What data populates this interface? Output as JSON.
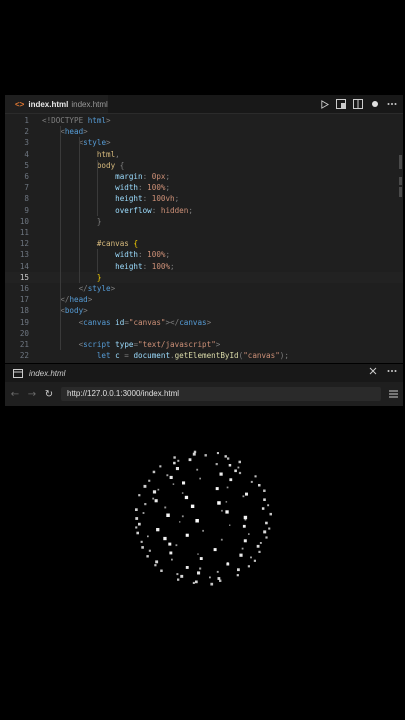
{
  "editor_tab": {
    "icon": "<>",
    "filename": "index.html",
    "path": "index.html"
  },
  "editor_toolbar": [
    "run-icon",
    "split-preview-icon",
    "split-editor-icon",
    "dirty-dot-icon",
    "more-icon"
  ],
  "code_lines": [
    {
      "num": "1",
      "parts": [
        [
          "cmt",
          "<!DOCTYPE "
        ],
        [
          "tag",
          "html"
        ],
        [
          "cmt",
          ">"
        ]
      ]
    },
    {
      "num": "2",
      "parts": [
        [
          "punct",
          "    <"
        ],
        [
          "tag",
          "head"
        ],
        [
          "punct",
          ">"
        ]
      ]
    },
    {
      "num": "3",
      "parts": [
        [
          "punct",
          "        <"
        ],
        [
          "tag",
          "style"
        ],
        [
          "punct",
          ">"
        ]
      ]
    },
    {
      "num": "4",
      "parts": [
        [
          "sel",
          "            html"
        ],
        [
          "punct",
          ","
        ]
      ]
    },
    {
      "num": "5",
      "parts": [
        [
          "sel",
          "            body"
        ],
        [
          "punct",
          " {"
        ]
      ]
    },
    {
      "num": "6",
      "parts": [
        [
          "attr",
          "                margin"
        ],
        [
          "punct",
          ": "
        ],
        [
          "val",
          "0px"
        ],
        [
          "punct",
          ";"
        ]
      ]
    },
    {
      "num": "7",
      "parts": [
        [
          "attr",
          "                width"
        ],
        [
          "punct",
          ": "
        ],
        [
          "val",
          "100%"
        ],
        [
          "punct",
          ";"
        ]
      ]
    },
    {
      "num": "8",
      "parts": [
        [
          "attr",
          "                height"
        ],
        [
          "punct",
          ": "
        ],
        [
          "val",
          "100vh"
        ],
        [
          "punct",
          ";"
        ]
      ]
    },
    {
      "num": "9",
      "parts": [
        [
          "attr",
          "                overflow"
        ],
        [
          "punct",
          ": "
        ],
        [
          "val",
          "hidden"
        ],
        [
          "punct",
          ";"
        ]
      ]
    },
    {
      "num": "10",
      "parts": [
        [
          "punct",
          "            }"
        ]
      ]
    },
    {
      "num": "11",
      "parts": []
    },
    {
      "num": "12",
      "parts": [
        [
          "sel",
          "            #canvas"
        ],
        [
          "punct",
          " "
        ],
        [
          "brk",
          "{"
        ]
      ]
    },
    {
      "num": "13",
      "parts": [
        [
          "attr",
          "                width"
        ],
        [
          "punct",
          ": "
        ],
        [
          "val",
          "100%"
        ],
        [
          "punct",
          ";"
        ]
      ]
    },
    {
      "num": "14",
      "parts": [
        [
          "attr",
          "                height"
        ],
        [
          "punct",
          ": "
        ],
        [
          "val",
          "100%"
        ],
        [
          "punct",
          ";"
        ]
      ]
    },
    {
      "num": "15",
      "parts": [
        [
          "brk",
          "            }"
        ]
      ]
    },
    {
      "num": "16",
      "parts": [
        [
          "punct",
          "        </"
        ],
        [
          "tag",
          "style"
        ],
        [
          "punct",
          ">"
        ]
      ]
    },
    {
      "num": "17",
      "parts": [
        [
          "punct",
          "    </"
        ],
        [
          "tag",
          "head"
        ],
        [
          "punct",
          ">"
        ]
      ]
    },
    {
      "num": "18",
      "parts": [
        [
          "punct",
          "    <"
        ],
        [
          "tag",
          "body"
        ],
        [
          "punct",
          ">"
        ]
      ]
    },
    {
      "num": "19",
      "parts": [
        [
          "punct",
          "        <"
        ],
        [
          "tag",
          "canvas"
        ],
        [
          "punct",
          " "
        ],
        [
          "attr",
          "id"
        ],
        [
          "punct",
          "="
        ],
        [
          "str",
          "\"canvas\""
        ],
        [
          "punct",
          "></"
        ],
        [
          "tag",
          "canvas"
        ],
        [
          "punct",
          ">"
        ]
      ]
    },
    {
      "num": "20",
      "parts": []
    },
    {
      "num": "21",
      "parts": [
        [
          "punct",
          "        <"
        ],
        [
          "tag",
          "script"
        ],
        [
          "punct",
          " "
        ],
        [
          "attr",
          "type"
        ],
        [
          "punct",
          "="
        ],
        [
          "str",
          "\"text/javascript\""
        ],
        [
          "punct",
          ">"
        ]
      ]
    },
    {
      "num": "22",
      "parts": [
        [
          "kw",
          "            let "
        ],
        [
          "var",
          "c"
        ],
        [
          "punct",
          " = "
        ],
        [
          "var",
          "document"
        ],
        [
          "punct",
          "."
        ],
        [
          "fn",
          "getElementById"
        ],
        [
          "punct",
          "("
        ],
        [
          "str",
          "\"canvas\""
        ],
        [
          "punct",
          ");"
        ]
      ]
    }
  ],
  "active_line": "15",
  "preview_tab": {
    "title": "index.html"
  },
  "preview_tools": [
    "close-icon",
    "more-icon"
  ],
  "url_bar": {
    "url": "http://127.0.0.1:3000/index.html"
  },
  "sphere_particles": {
    "count": 120,
    "seed": 7
  }
}
